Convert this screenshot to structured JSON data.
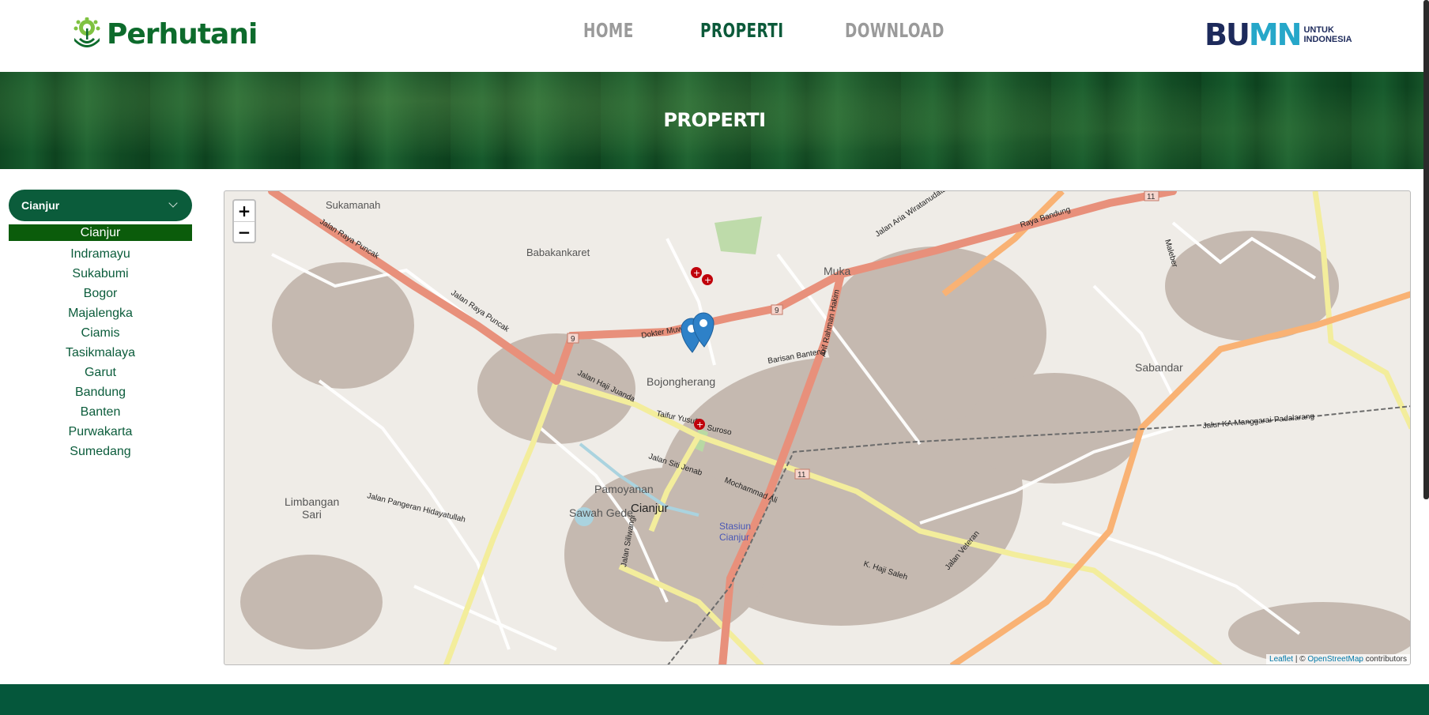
{
  "header": {
    "logo_text": "Perhutani",
    "nav": [
      "HOME",
      "PROPERTI",
      "DOWNLOAD"
    ],
    "partner_logo": {
      "word_a": "BU",
      "word_b": "MN",
      "tagline_1": "UNTUK",
      "tagline_2": "INDONESIA"
    }
  },
  "banner": {
    "title": "PROPERTI"
  },
  "sidebar": {
    "selected": "Cianjur",
    "options": [
      "Cianjur",
      "Indramayu",
      "Sukabumi",
      "Bogor",
      "Majalengka",
      "Ciamis",
      "Tasikmalaya",
      "Garut",
      "Bandung",
      "Banten",
      "Purwakarta",
      "Sumedang"
    ]
  },
  "map": {
    "zoom_in": "+",
    "zoom_out": "−",
    "attribution_leaflet": "Leaflet",
    "attribution_sep": " | © ",
    "attribution_osm": "OpenStreetMap",
    "attribution_tail": " contributors",
    "places": [
      "Sukamanah",
      "Babakankaret",
      "Muka",
      "Bojongherang",
      "Sabandar",
      "Pamoyanan",
      "Cianjur",
      "Sawah Gede",
      "Limbangan Sari",
      "Stasiun Cianjur"
    ],
    "roads": [
      "Jalan Raya Puncak",
      "Dokter Muwardi",
      "Raya Bandung",
      "Barisan Banteng",
      "Jalan Aria Wiratanudatar",
      "Arif Rahman Hakim",
      "Jalan Haji Juanda",
      "Taifur Yusuf",
      "Suroso",
      "Jalan Siti Jenab",
      "Mochammad Ali",
      "Jalan Veteran",
      "K. Haji Saleh",
      "Jalan Pangeran Hidayatullah",
      "Maleber",
      "Jalur KA Manggarai-Padalarang",
      "Jalan Siliwangi"
    ],
    "route_numbers": [
      "9",
      "9",
      "11",
      "11"
    ]
  },
  "colors": {
    "brand_green": "#0b5c3b",
    "selected_option": "#0b5c0b",
    "footer": "#05573b"
  }
}
